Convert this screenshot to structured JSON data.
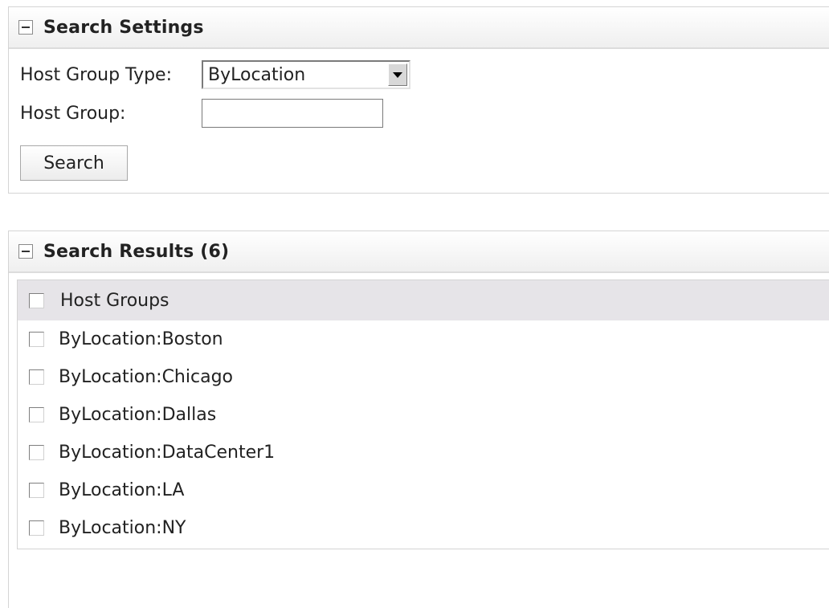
{
  "settings": {
    "title": "Search Settings",
    "host_group_type_label": "Host Group Type:",
    "host_group_type_value": "ByLocation",
    "host_group_label": "Host Group:",
    "host_group_value": "",
    "search_button": "Search"
  },
  "results": {
    "title": "Search Results (6)",
    "column_header": "Host Groups",
    "rows": [
      "ByLocation:Boston",
      "ByLocation:Chicago",
      "ByLocation:Dallas",
      "ByLocation:DataCenter1",
      "ByLocation:LA",
      "ByLocation:NY"
    ]
  },
  "icons": {
    "collapse": "minus-box-icon",
    "dropdown": "chevron-down-icon",
    "checkbox": "checkbox-unchecked"
  }
}
